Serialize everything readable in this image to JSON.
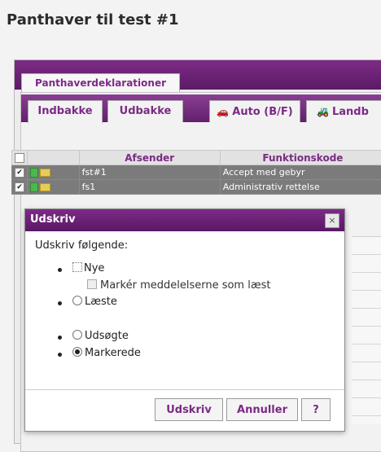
{
  "page": {
    "title": "Panthaver til test #1"
  },
  "outer_tabs": [
    {
      "label": "Panthaverdeklarationer"
    }
  ],
  "inner_tabs": {
    "indbakke": "Indbakke",
    "udbakke": "Udbakke",
    "auto": "Auto (B/F)",
    "landb": "Landb"
  },
  "grid": {
    "columns": {
      "afsender": "Afsender",
      "funktionskode": "Funktionskode"
    },
    "rows": [
      {
        "afsender": "fst#1",
        "funktionskode": "Accept med gebyr"
      },
      {
        "afsender": "fs1",
        "funktionskode": "Administrativ rettelse"
      }
    ]
  },
  "dialog": {
    "title": "Udskriv",
    "close_symbol": "×",
    "heading": "Udskriv følgende:",
    "options": {
      "nye": "Nye",
      "marker_laest": "Markér meddelelserne som læst",
      "laeste": "Læste",
      "udsogte": "Udsøgte",
      "markerede": "Markerede"
    },
    "selected": "markerede",
    "buttons": {
      "print": "Udskriv",
      "cancel": "Annuller",
      "help": "?"
    }
  },
  "colors": {
    "accent": "#7b2a85",
    "selected_row": "#7b7b7b"
  }
}
